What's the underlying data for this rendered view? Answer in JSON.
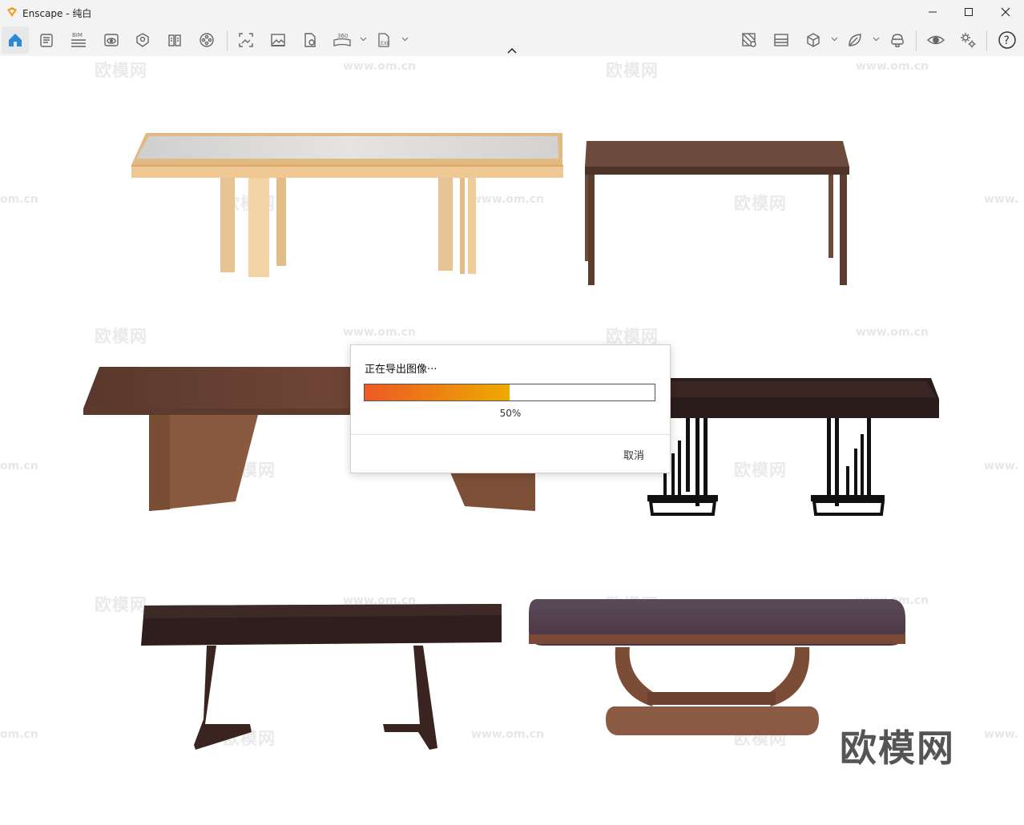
{
  "window": {
    "app_name": "Enscape",
    "separator": " - ",
    "scene": "纯白",
    "accent": "#f29a1f"
  },
  "titlebar_controls": [
    "minimize-icon",
    "maximize-icon",
    "close-icon"
  ],
  "toolbar": {
    "left_buttons": [
      {
        "name": "home-icon",
        "active": true
      },
      {
        "name": "document-icon"
      },
      {
        "name": "bim-icon",
        "label": "BIM"
      },
      {
        "name": "visual-settings-eye-icon"
      },
      {
        "name": "location-icon"
      },
      {
        "name": "book-icon"
      },
      {
        "name": "video-reel-icon"
      },
      {
        "name": "screenshot-icon"
      },
      {
        "name": "image-icon"
      },
      {
        "name": "render-export-icon"
      },
      {
        "name": "panorama-360-icon",
        "label": "360"
      },
      {
        "name": "exe-export-icon",
        "label": "EXE"
      }
    ],
    "right_buttons": [
      {
        "name": "material-icon"
      },
      {
        "name": "image-view-icon"
      },
      {
        "name": "cube-icon"
      },
      {
        "name": "leaf-icon"
      },
      {
        "name": "vr-headset-icon"
      },
      {
        "name": "eye-icon"
      },
      {
        "name": "gears-icon"
      },
      {
        "name": "help-icon",
        "label": "?"
      }
    ]
  },
  "watermarks": {
    "logo_text": "欧模网",
    "url_text": "www.om.cn",
    "url_partial": "om.cn",
    "url_partial_right": "www."
  },
  "brand_mark": "欧模网",
  "dialog": {
    "message": "正在导出图像···",
    "progress": 0.5,
    "percent_label": "50%",
    "cancel_label": "取消"
  },
  "colors": {
    "progress_start": "#ec5a25",
    "progress_end": "#eeaa00"
  }
}
